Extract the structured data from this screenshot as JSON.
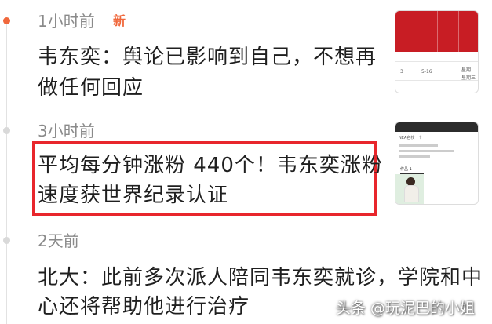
{
  "feed": {
    "items": [
      {
        "time": "1小时前",
        "badge": "新",
        "line1": "韦东奕：舆论已影响到自己，不想再",
        "line2": "做任何回应"
      },
      {
        "time": "3小时前",
        "line1": "平均每分钟涨粉 440个！韦东奕涨粉",
        "line2": "速度获世界纪录认证"
      },
      {
        "time": "2天前",
        "line1": "北大：此前多次派人陪同韦东奕就诊，学院和中",
        "line2": "心还将帮助他进行治疗"
      }
    ]
  },
  "thumb1": {
    "cells": [
      "3",
      "5-16",
      "星期",
      "星期三"
    ]
  },
  "thumb2": {
    "header": "NEA名校一个",
    "tab": "作品 1"
  },
  "watermark": "头条 @玩泥巴的小姐",
  "colors": {
    "accent": "#f0683c",
    "highlight_border": "#e8262c",
    "thumb_red": "#c81d24"
  }
}
